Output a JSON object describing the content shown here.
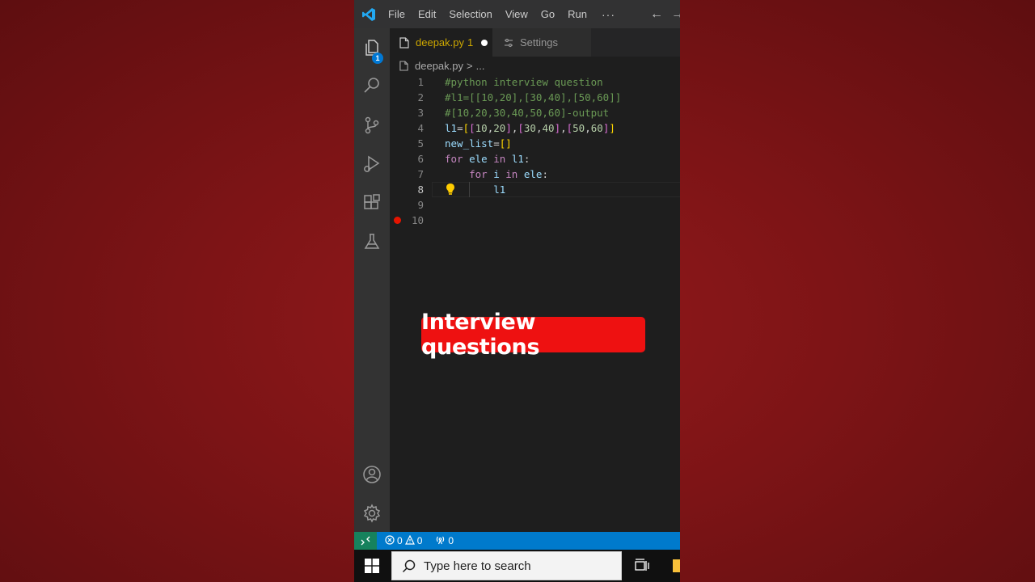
{
  "menu": [
    "File",
    "Edit",
    "Selection",
    "View",
    "Go",
    "Run"
  ],
  "menu_more": "···",
  "nav": {
    "back": "←",
    "forward": "→"
  },
  "activity_bar": {
    "items": [
      "explorer-icon",
      "search-icon",
      "source-control-icon",
      "run-debug-icon",
      "extensions-icon",
      "testing-icon"
    ],
    "explorer_badge": "1",
    "bottom": [
      "account-icon",
      "manage-gear-icon"
    ]
  },
  "tabs": [
    {
      "label": "deepak.py",
      "problems": "1",
      "dirty": true,
      "active": true
    },
    {
      "label": "Settings",
      "active": false
    }
  ],
  "breadcrumb": {
    "file": "deepak.py",
    "separator": ">",
    "more": "..."
  },
  "editor": {
    "active_line": 8,
    "breakpoint_line": 10,
    "lines": [
      "1",
      "2",
      "3",
      "4",
      "5",
      "6",
      "7",
      "8",
      "9",
      "10"
    ],
    "code": [
      "#python interview question",
      "#l1=[[10,20],[30,40],[50,60]]",
      "#[10,20,30,40,50,60]-output",
      "l1=[[10,20],[30,40],[50,60]]",
      "new_list=[]",
      "for ele in l1:",
      "    for i in ele:",
      "        l1",
      "",
      ""
    ]
  },
  "status_bar": {
    "errors": "0",
    "warnings": "0",
    "ports": "0"
  },
  "taskbar": {
    "search_placeholder": "Type here to search"
  },
  "overlay_caption": "Interview questions",
  "colors": {
    "background": "#7d1416",
    "editor_bg": "#1e1e1e",
    "status_bar": "#007acc",
    "overlay": "#ee1111",
    "modified_tab": "#cca700"
  }
}
